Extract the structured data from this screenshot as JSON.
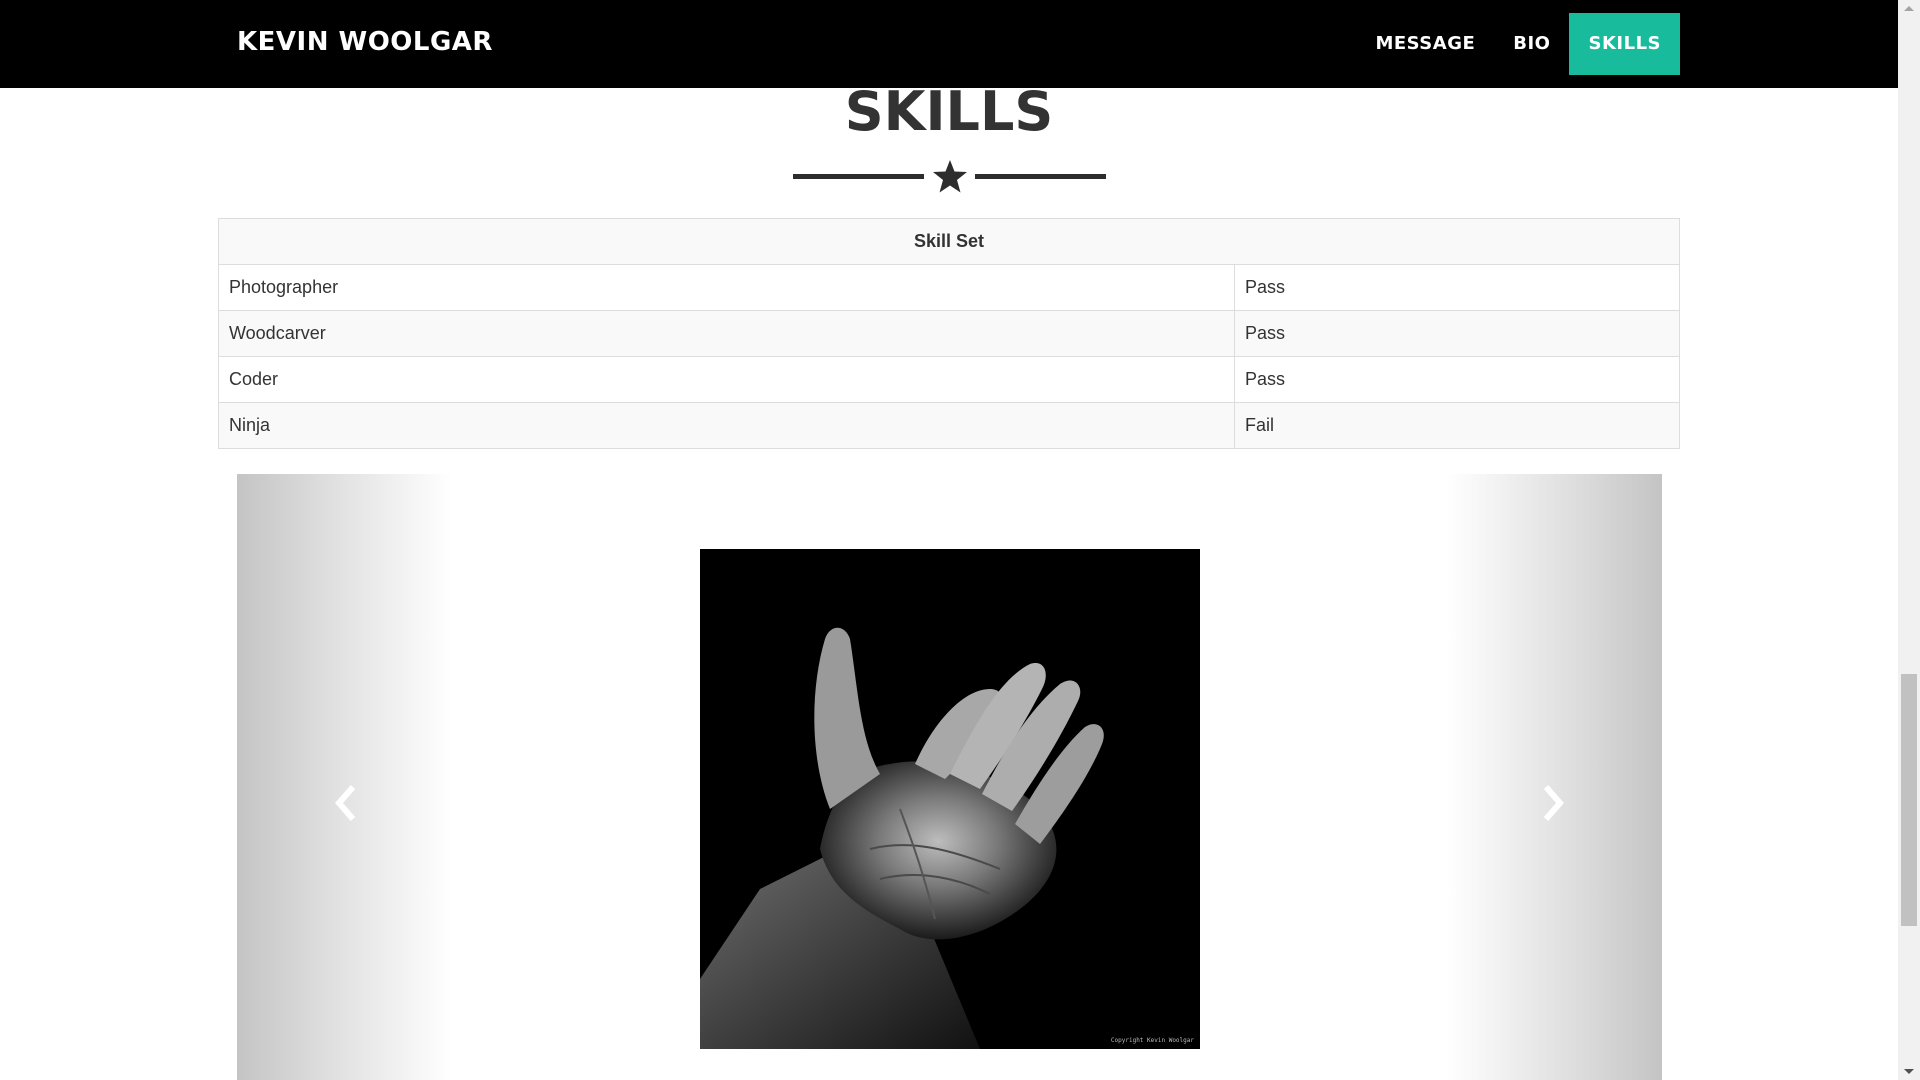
{
  "navbar": {
    "brand": "KEVIN WOOLGAR",
    "links": [
      {
        "label": "MESSAGE"
      },
      {
        "label": "BIO"
      },
      {
        "label": "SKILLS"
      }
    ],
    "active_color": "#18bc9c"
  },
  "section": {
    "title": "SKILLS",
    "divider_icon": "star-icon"
  },
  "table": {
    "header": "Skill Set",
    "rows": [
      {
        "skill": "Photographer",
        "result": "Pass"
      },
      {
        "skill": "Woodcarver",
        "result": "Pass"
      },
      {
        "skill": "Coder",
        "result": "Pass"
      },
      {
        "skill": "Ninja",
        "result": "Fail"
      }
    ]
  },
  "carousel": {
    "prev_icon": "chevron-left-icon",
    "next_icon": "chevron-right-icon",
    "photo_caption": "Copyright Kevin Woolgar"
  }
}
